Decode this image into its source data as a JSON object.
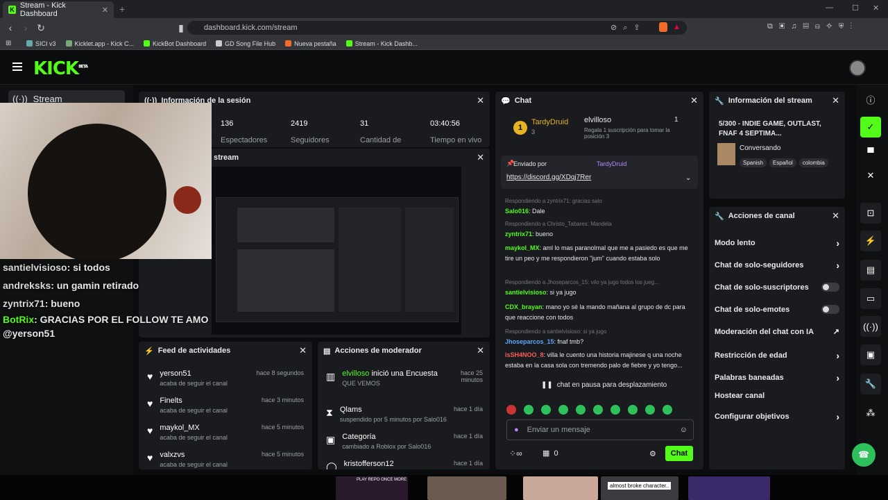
{
  "browser": {
    "tab_title": "Stream - Kick Dashboard",
    "tab_icon": "K",
    "url": "dashboard.kick.com/stream",
    "bookmarks": [
      "SICI v3",
      "Kicklet.app - Kick C...",
      "KickBot Dashboard",
      "GD Song File Hub",
      "Nueva pestaña",
      "Stream - Kick Dashb..."
    ]
  },
  "header": {
    "logo": "KICK",
    "logo_badge": "BETA"
  },
  "sidebar": {
    "active_item": "Stream"
  },
  "session": {
    "title": "Información de la sesión",
    "stats": [
      {
        "value": "136",
        "label": "Espectadores"
      },
      {
        "value": "2419",
        "label": "Seguidores"
      },
      {
        "value": "31",
        "label": "Cantidad de"
      },
      {
        "value": "03:40:56",
        "label": "Tiempo en vivo"
      }
    ]
  },
  "preview": {
    "title": "stream"
  },
  "overlay_chat": [
    {
      "user": "santielvisioso",
      "text": ": si todos",
      "color": "#d9d9d9"
    },
    {
      "user": "andreksks",
      "text": ": un gamin retirado",
      "color": "#d9d9d9"
    },
    {
      "user": "zyntrix71",
      "text": ": bueno",
      "color": "#d9d9d9"
    },
    {
      "user": "BotRix",
      "text": ": GRACIAS POR EL FOLLOW TE AMO @yerson51",
      "color": "#53fc18"
    }
  ],
  "feed": {
    "title": "Feed de actividades",
    "items": [
      {
        "user": "yerson51",
        "action": "acaba de seguir el canal",
        "time": "hace 8 segundos"
      },
      {
        "user": "Finelts",
        "action": "acaba de seguir el canal",
        "time": "hace 3 minutos"
      },
      {
        "user": "maykol_MX",
        "action": "acaba de seguir el canal",
        "time": "hace 5 minutos"
      },
      {
        "user": "valxzvs",
        "action": "acaba de seguir el canal",
        "time": "hace 5 minutos"
      }
    ]
  },
  "mod_actions": {
    "title": "Acciones de moderador",
    "items": [
      {
        "actor": "elvilloso",
        "action": "inició una Encuesta",
        "detail": "QUE VEMOS",
        "time": "hace 25 minutos"
      },
      {
        "actor": "Qlams",
        "action": "",
        "detail": "suspendido por 5 minutos por Salo016",
        "time": "hace 1 día"
      },
      {
        "actor": "Categoría",
        "action": "",
        "detail": "cambiado a Roblox por Salo016",
        "time": "hace 1 día"
      },
      {
        "actor": "kristofferson12",
        "action": "",
        "detail": "",
        "time": "hace 1 día"
      }
    ]
  },
  "chat": {
    "title": "Chat",
    "top_gifter": "TardyDruid",
    "top_gifter_count": "3",
    "gift_user": "elvilloso",
    "gift_count": "1",
    "gift_text": "Regala 1 suscripción para tomar la posición 3",
    "pinned_label": "Enviado por",
    "pinned_user": "TardyDruid",
    "pinned_link": "https://discord.gg/XDqj7Rer",
    "messages": [
      {
        "reply": "Respondiendo a zyntrix71: gracias salo",
        "user": "Salo016",
        "text": ": Dale",
        "color": "#53fc18"
      },
      {
        "reply": "Respondiendo a Christo_Tabares: Mandela",
        "user": "zyntrix71",
        "text": ": bueno",
        "color": "#53fc18"
      },
      {
        "reply": "",
        "user": "maykol_MX",
        "text": ": aml lo mas paranolmal que me a pasiedo es que me tire un peo y me respondieron \"jum\" cuando estaba solo",
        "color": "#53fc18"
      },
      {
        "reply": "Respondiendo a Jhoseparcos_15: vilo ya jugo todos los jueg...",
        "user": "santielvisioso",
        "text": ": si ya jugo",
        "color": "#53fc18"
      },
      {
        "reply": "",
        "user": "CDX_brayan",
        "text": ": mano yo sé la mando mañana al grupo de dc para que reaccione con todos",
        "color": "#53fc18"
      },
      {
        "reply": "Respondiendo a santielvisioso: si ya jugo",
        "user": "Jhoseparcos_15",
        "text": ": fnaf tmb?",
        "color": "#5aa9ff"
      },
      {
        "reply": "",
        "user": "isSH4NOO_8",
        "text": ": villa le cuento una historia majinese q una noche estaba en la casa sola con tremendo palo de fiebre y yo tengo...",
        "color": "#ff5c5c"
      }
    ],
    "paused": "chat en pausa para desplazamiento",
    "input_placeholder": "Enviar un mensaje",
    "points": "∞",
    "store_count": "0",
    "send_label": "Chat"
  },
  "stream_info": {
    "title": "Información del stream",
    "stream_title": "5/300 - INDIE GAME, OUTLAST, FNAF 4 SEPTIMA...",
    "category": "Conversando",
    "tags": [
      "Spanish",
      "Español",
      "colombia"
    ]
  },
  "channel_actions": {
    "title": "Acciones de canal",
    "items": [
      {
        "label": "Modo lento",
        "control": "chevron"
      },
      {
        "label": "Chat de solo-seguidores",
        "control": "chevron"
      },
      {
        "label": "Chat de solo-suscriptores",
        "control": "toggle"
      },
      {
        "label": "Chat de solo-emotes",
        "control": "toggle"
      },
      {
        "label": "Moderación del chat con IA",
        "control": "external"
      },
      {
        "label": "Restricción de edad",
        "control": "chevron"
      },
      {
        "label": "Palabras baneadas",
        "control": "chevron"
      },
      {
        "label": "Hostear canal",
        "control": "none"
      },
      {
        "label": "Configurar objetivos",
        "control": "chevron"
      }
    ]
  },
  "bottom": {
    "thumb_label": "almost broke character..",
    "thumb_label2": "PLAY REPO ONCE MORE"
  },
  "colors": {
    "accent": "#53fc18",
    "panel": "#191b1f"
  }
}
